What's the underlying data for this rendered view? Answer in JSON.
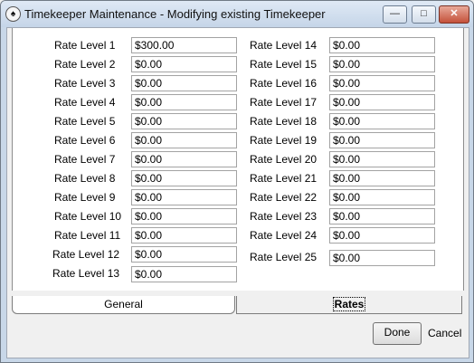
{
  "window": {
    "title": "Timekeeper Maintenance - Modifying existing Timekeeper",
    "app_icon_glyph": "♠",
    "min_glyph": "—",
    "max_glyph": "□",
    "close_glyph": "✕"
  },
  "rates_left": [
    {
      "label": "Rate Level 1",
      "value": "$300.00"
    },
    {
      "label": "Rate Level 2",
      "value": "$0.00"
    },
    {
      "label": "Rate Level 3",
      "value": "$0.00"
    },
    {
      "label": "Rate Level 4",
      "value": "$0.00"
    },
    {
      "label": "Rate Level 5",
      "value": "$0.00"
    },
    {
      "label": "Rate Level 6",
      "value": "$0.00"
    },
    {
      "label": "Rate Level 7",
      "value": "$0.00"
    },
    {
      "label": "Rate Level 8",
      "value": "$0.00"
    },
    {
      "label": "Rate Level 9",
      "value": "$0.00"
    },
    {
      "label": "Rate Level 10",
      "value": "$0.00"
    },
    {
      "label": "Rate Level 11",
      "value": "$0.00"
    },
    {
      "label": "Rate Level 12",
      "value": "$0.00"
    },
    {
      "label": "Rate Level 13",
      "value": "$0.00"
    }
  ],
  "rates_right": [
    {
      "label": "Rate Level 14",
      "value": "$0.00"
    },
    {
      "label": "Rate Level 15",
      "value": "$0.00"
    },
    {
      "label": "Rate Level 16",
      "value": "$0.00"
    },
    {
      "label": "Rate Level 17",
      "value": "$0.00"
    },
    {
      "label": "Rate Level 18",
      "value": "$0.00"
    },
    {
      "label": "Rate Level 19",
      "value": "$0.00"
    },
    {
      "label": "Rate Level 20",
      "value": "$0.00"
    },
    {
      "label": "Rate Level 21",
      "value": "$0.00"
    },
    {
      "label": "Rate Level 22",
      "value": "$0.00"
    },
    {
      "label": "Rate Level 23",
      "value": "$0.00"
    },
    {
      "label": "Rate Level 24",
      "value": "$0.00"
    },
    {
      "label": "Rate Level 25",
      "value": "$0.00"
    }
  ],
  "tabs": {
    "general": "General",
    "rates": "Rates"
  },
  "buttons": {
    "done": "Done",
    "cancel": "Cancel"
  }
}
